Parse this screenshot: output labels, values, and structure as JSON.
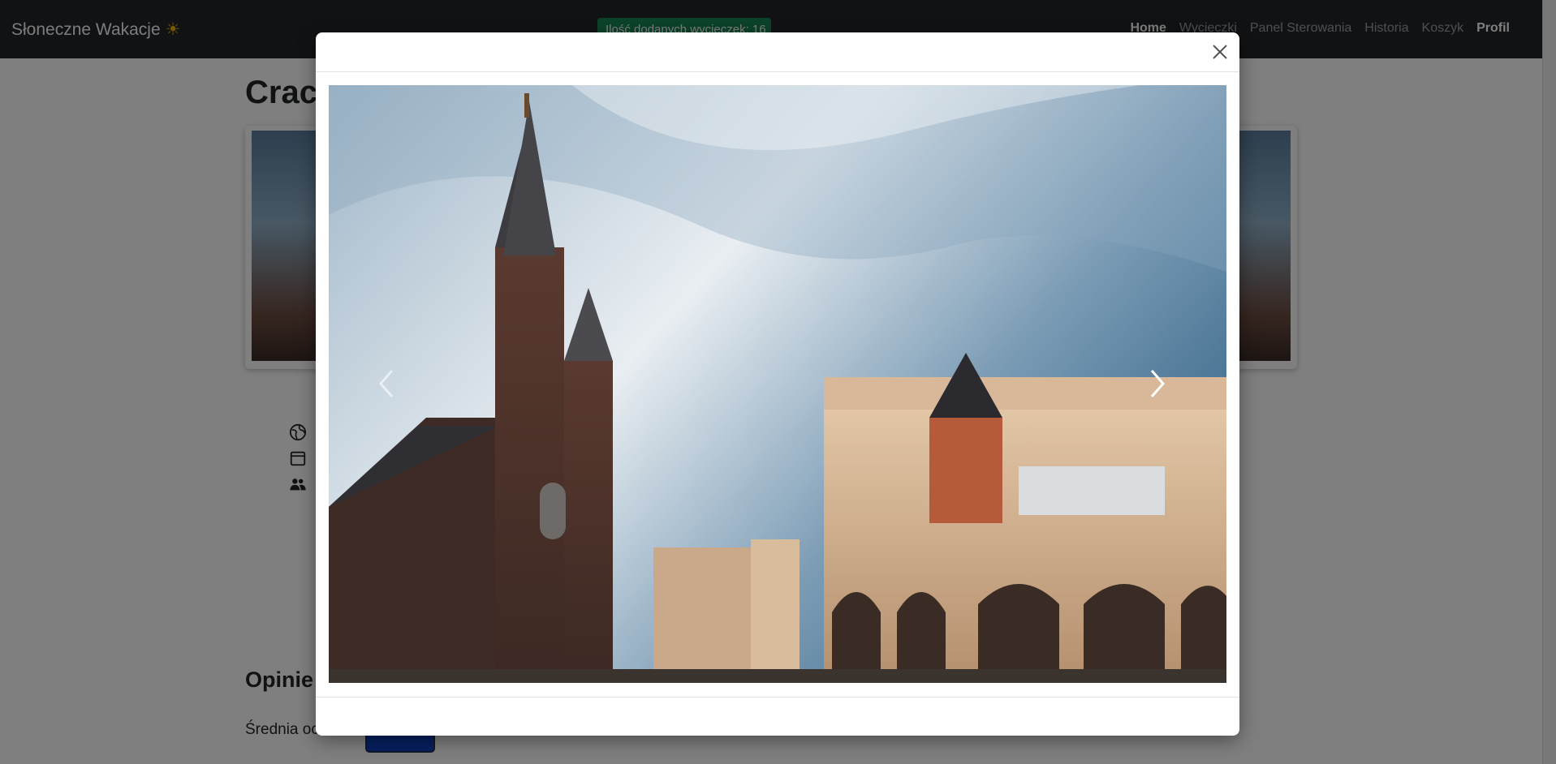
{
  "navbar": {
    "brand": "Słoneczne Wakacje",
    "brand_icon": "☀",
    "counter_badge": "Ilość dodanych wycieczek: 16",
    "links": [
      {
        "label": "Home",
        "active": true
      },
      {
        "label": "Wycieczki",
        "active": false
      },
      {
        "label": "Panel Sterowania",
        "active": false
      },
      {
        "label": "Historia",
        "active": false
      },
      {
        "label": "Koszyk",
        "active": false
      },
      {
        "label": "Profil",
        "active": true
      }
    ]
  },
  "page": {
    "title_partial": "Craco",
    "info_icons": [
      "globe-icon",
      "calendar-icon",
      "people-icon"
    ],
    "reviews_heading_partial": "Opinie",
    "average_label_partial": "Średnia oc..."
  },
  "modal": {
    "close_icon": "close-icon",
    "prev_icon": "chevron-left-icon",
    "next_icon": "chevron-right-icon",
    "image_subject": "Kraków Main Market Square"
  },
  "colors": {
    "navbar_bg": "#212529",
    "badge_bg": "#198754",
    "avg_box": "#0d3fbf"
  }
}
